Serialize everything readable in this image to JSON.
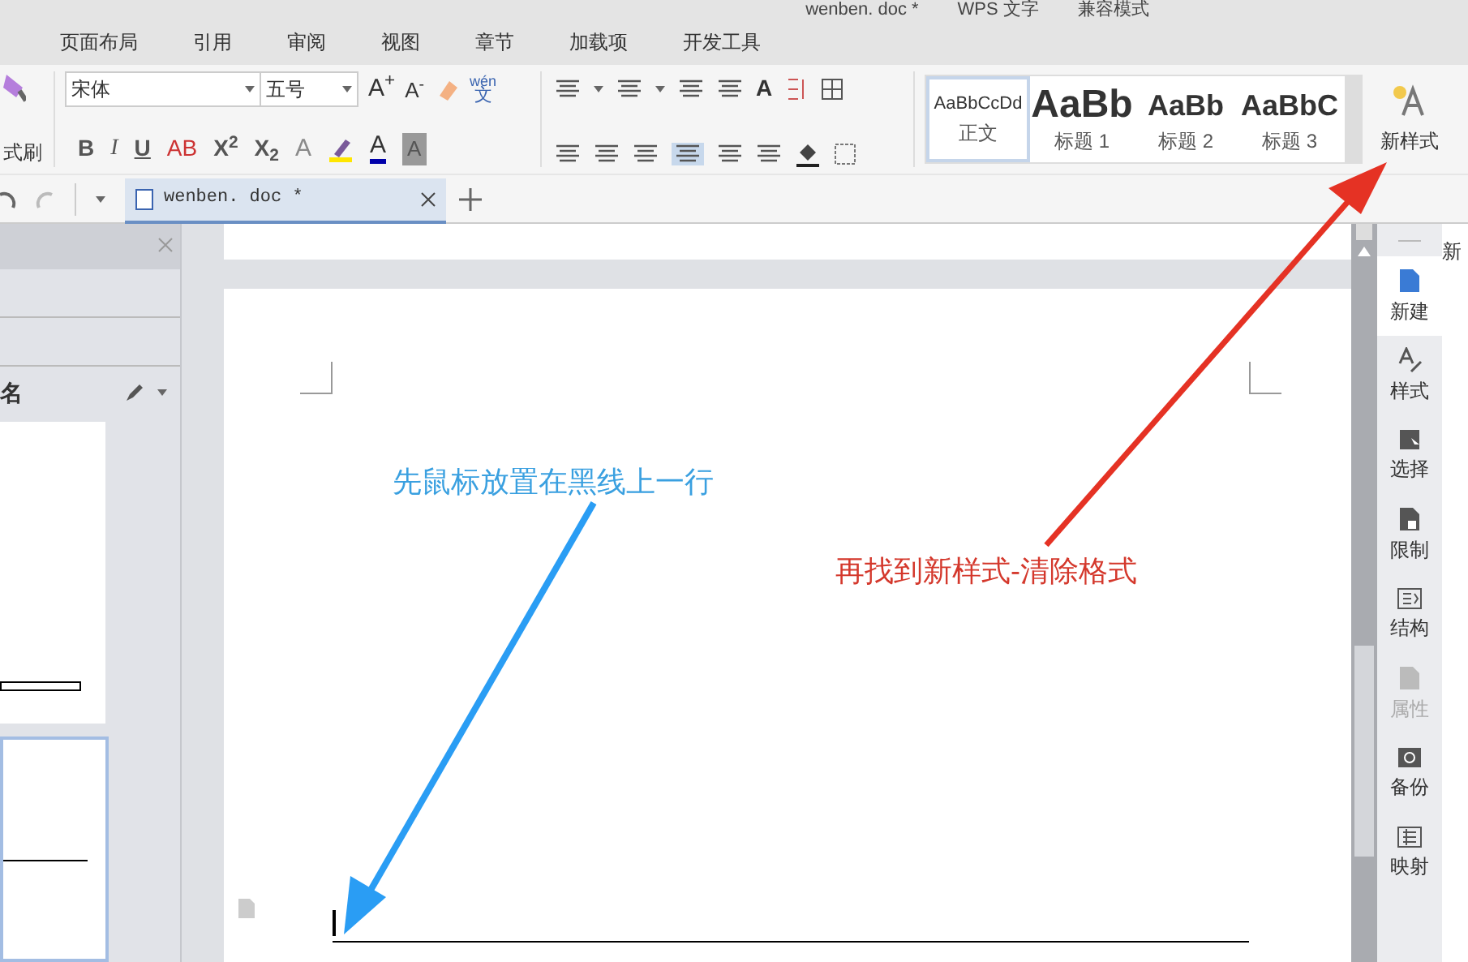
{
  "title_bar": {
    "texts": [
      "wenben. doc *",
      "WPS 文字",
      "兼容模式"
    ]
  },
  "menu_tabs": [
    {
      "label": "页面布局",
      "selected": false
    },
    {
      "label": "引用",
      "selected": false
    },
    {
      "label": "审阅",
      "selected": false
    },
    {
      "label": "视图",
      "selected": false
    },
    {
      "label": "章节",
      "selected": false
    },
    {
      "label": "加载项",
      "selected": false
    },
    {
      "label": "开发工具",
      "selected": false
    }
  ],
  "ribbon": {
    "format_painter": "式刷",
    "font_name": "宋体",
    "font_size": "五号",
    "grow": "A$^{+}$",
    "shrink": "A$^{-}$",
    "phonetic_top": "wén",
    "phonetic_bottom": "文",
    "format_buttons": [
      {
        "kind": "bold",
        "label": "B"
      },
      {
        "kind": "italic",
        "label": "I"
      },
      {
        "kind": "underline",
        "label": "U"
      },
      {
        "kind": "strike",
        "label": "AB"
      },
      {
        "kind": "plain",
        "label": "X$^{2}$"
      },
      {
        "kind": "plain",
        "label": "X$_{2}$"
      }
    ],
    "text_effect": "A",
    "font_color": "A",
    "shading": "A",
    "sort_label": "A",
    "styles": [
      {
        "preview": "AaBbCcDd",
        "label": "正文",
        "selected": true
      },
      {
        "preview": "AaBb",
        "label": "标题 1",
        "selected": false
      },
      {
        "preview": "AaBb",
        "label": "标题 2",
        "selected": false
      },
      {
        "preview": "AaBbC",
        "label": "标题 3",
        "selected": false
      }
    ],
    "new_style": "新样式"
  },
  "doc_tab": {
    "label": "wenben. doc *"
  },
  "left_panel": {
    "heading": "名"
  },
  "annotations": {
    "blue": "先鼠标放置在黑线上一行",
    "red": "再找到新样式-清除格式"
  },
  "sidebar": [
    {
      "label": "新建",
      "disabled": false,
      "kind": "new"
    },
    {
      "label": "样式",
      "disabled": false,
      "kind": "style"
    },
    {
      "label": "选择",
      "disabled": false,
      "kind": "select"
    },
    {
      "label": "限制",
      "disabled": false,
      "kind": "lock"
    },
    {
      "label": "结构",
      "disabled": false,
      "kind": "structure"
    },
    {
      "label": "属性",
      "disabled": true,
      "kind": "props"
    },
    {
      "label": "备份",
      "disabled": false,
      "kind": "backup"
    },
    {
      "label": "映射",
      "disabled": false,
      "kind": "map"
    }
  ],
  "edge_panel": {
    "text": "新"
  }
}
